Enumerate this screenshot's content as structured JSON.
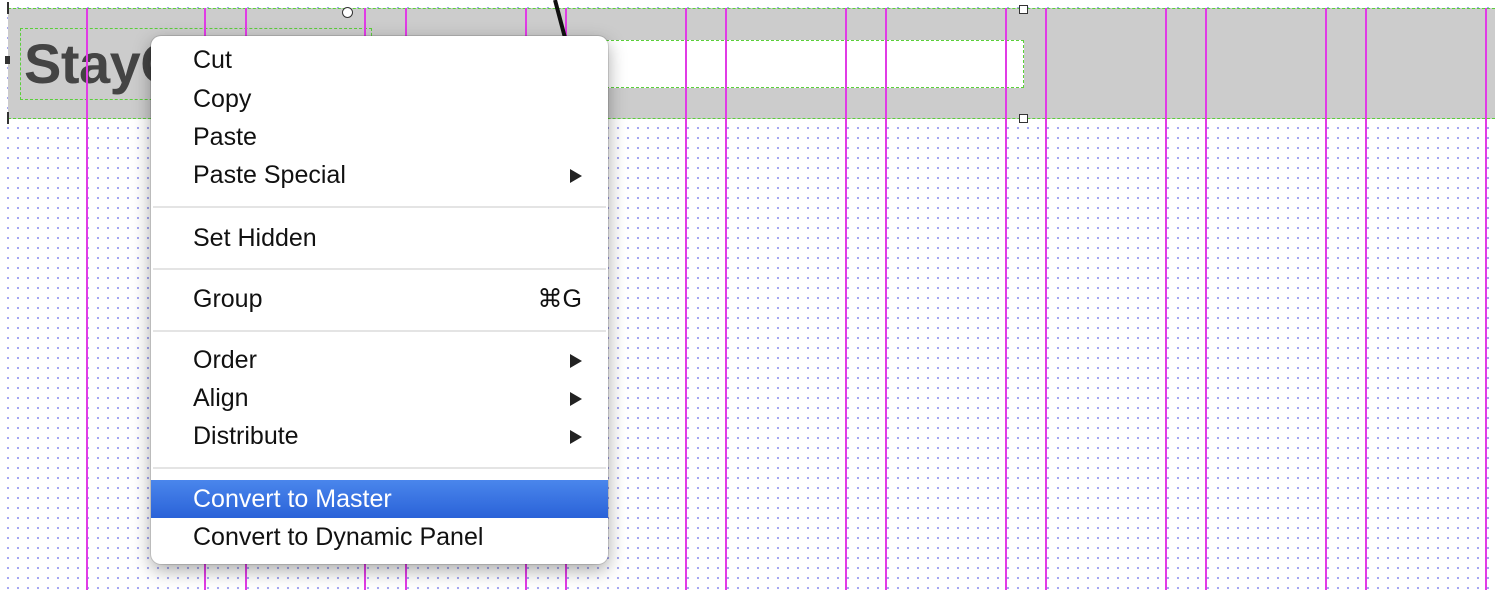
{
  "header": {
    "logo_text": "StayCation"
  },
  "context_menu": {
    "items": [
      {
        "label": "Cut",
        "submenu": false,
        "shortcut": ""
      },
      {
        "label": "Copy",
        "submenu": false,
        "shortcut": ""
      },
      {
        "label": "Paste",
        "submenu": false,
        "shortcut": ""
      },
      {
        "label": "Paste Special",
        "submenu": true,
        "shortcut": ""
      },
      {
        "label": "Set Hidden",
        "submenu": false,
        "shortcut": ""
      },
      {
        "label": "Group",
        "submenu": false,
        "shortcut": "⌘G"
      },
      {
        "label": "Order",
        "submenu": true,
        "shortcut": ""
      },
      {
        "label": "Align",
        "submenu": true,
        "shortcut": ""
      },
      {
        "label": "Distribute",
        "submenu": true,
        "shortcut": ""
      },
      {
        "label": "Convert to Master",
        "submenu": false,
        "shortcut": "",
        "highlighted": true
      },
      {
        "label": "Convert to Dynamic Panel",
        "submenu": false,
        "shortcut": ""
      }
    ],
    "highlight_color": "#2f6fe0"
  },
  "colors": {
    "guide_lines": "#e13be6",
    "selection_border": "#5acf3a",
    "header_background": "#cccccc",
    "grid_dots": "#9a9cf0"
  },
  "icons": {
    "submenu_indicator": "submenu-arrow-icon",
    "annotation_arrow": "arrow-pointer-icon"
  }
}
